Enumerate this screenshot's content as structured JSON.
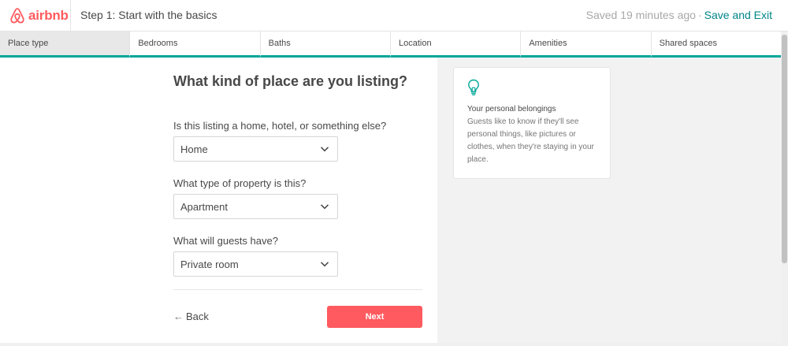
{
  "header": {
    "logo_text": "airbnb",
    "step_title": "Step 1: Start with the basics",
    "saved_text": "Saved 19 minutes ago",
    "separator": "·",
    "save_exit_label": "Save and Exit"
  },
  "tabs": [
    {
      "label": "Place type",
      "active": true
    },
    {
      "label": "Bedrooms",
      "active": false
    },
    {
      "label": "Baths",
      "active": false
    },
    {
      "label": "Location",
      "active": false
    },
    {
      "label": "Amenities",
      "active": false
    },
    {
      "label": "Shared spaces",
      "active": false
    }
  ],
  "main": {
    "title": "What kind of place are you listing?",
    "fields": [
      {
        "label": "Is this listing a home, hotel, or something else?",
        "value": "Home"
      },
      {
        "label": "What type of property is this?",
        "value": "Apartment"
      },
      {
        "label": "What will guests have?",
        "value": "Private room"
      }
    ],
    "back_label": "Back",
    "back_arrow": "←",
    "next_label": "Next"
  },
  "tip": {
    "icon": "lightbulb-icon",
    "title": "Your personal belongings",
    "body": "Guests like to know if they'll see personal things, like pictures or clothes, when they're staying in your place."
  },
  "colors": {
    "brand": "#FF5A5F",
    "accent": "#00A699",
    "link": "#008489"
  }
}
